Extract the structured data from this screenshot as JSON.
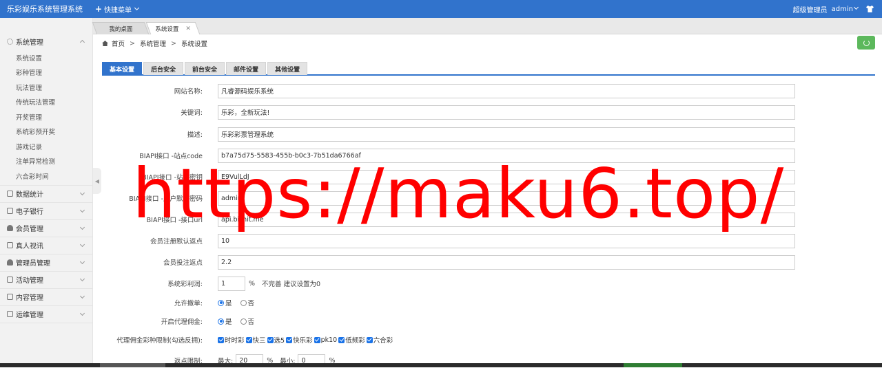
{
  "header": {
    "brand": "乐彩娱乐系统管理系统",
    "quick_menu": "快捷菜单",
    "role": "超级管理员",
    "user": "admin"
  },
  "sidebar": {
    "groups": [
      {
        "label": "系统管理",
        "icon": "gear-icon",
        "expanded": true
      },
      {
        "label": "数据统计",
        "icon": "chart-icon"
      },
      {
        "label": "电子银行",
        "icon": "bank-icon"
      },
      {
        "label": "会员管理",
        "icon": "user-icon"
      },
      {
        "label": "真人视讯",
        "icon": "video-icon"
      },
      {
        "label": "管理员管理",
        "icon": "admin-icon"
      },
      {
        "label": "活动管理",
        "icon": "activity-icon"
      },
      {
        "label": "内容管理",
        "icon": "content-icon"
      },
      {
        "label": "运维管理",
        "icon": "ops-icon"
      }
    ],
    "sub_items": [
      "系统设置",
      "彩种管理",
      "玩法管理",
      "传统玩法管理",
      "开奖管理",
      "系统彩预开奖",
      "游戏记录",
      "注单异常检测",
      "六合彩时间"
    ]
  },
  "tabs": {
    "desktop": "我的桌面",
    "settings": "系统设置"
  },
  "breadcrumb": [
    "首页",
    "系统管理",
    "系统设置"
  ],
  "settings_tabs": [
    "基本设置",
    "后台安全",
    "前台安全",
    "邮件设置",
    "其他设置"
  ],
  "form": {
    "site_name_label": "网站名称:",
    "site_name": "凡睿源码娱乐系统",
    "keywords_label": "关键词:",
    "keywords": "乐彩，全新玩法!",
    "desc_label": "描述:",
    "desc": "乐彩彩票管理系统",
    "api_code_label": "BIAPI接口 -站点code",
    "api_code": "b7a75d75-5583-455b-b0c3-7b51da6766af",
    "api_key_label": "BIAPI接口 -站点密钥",
    "api_key": "E9VulLdJ",
    "api_pwd_label": "BIAPI接口 -用户默认密码",
    "api_pwd": "admin",
    "api_url_label": "BIAPI接口 -接口url",
    "api_url": "api.bishit.me",
    "reg_rebate_label": "会员注册默认返点",
    "reg_rebate": "10",
    "bet_rebate_label": "会员投注返点",
    "bet_rebate": "2.2",
    "profit_label": "系统彩利润:",
    "profit": "1",
    "profit_unit": "%",
    "profit_hint": "不完善 建议设置为0",
    "cancel_label": "允许撤单:",
    "agent_label": "开启代理佣金:",
    "yes": "是",
    "no": "否",
    "limit_label": "代理佣金彩种限制(勾选反拥):",
    "lotteries": [
      "时时彩",
      "快三",
      "选5",
      "快乐彩",
      "pk10",
      "低频彩",
      "六合彩"
    ],
    "range_label": "返点限制:",
    "max_label": "最大:",
    "max": "20",
    "min_label": "最小:",
    "min": "0",
    "pct": "%"
  },
  "watermark": "https://maku6.top/"
}
